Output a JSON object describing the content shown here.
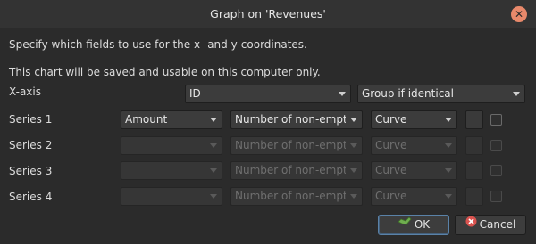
{
  "dialog": {
    "title": "Graph on 'Revenues'",
    "intro_line1": "Specify which fields to use for the x- and y-coordinates.",
    "intro_line2": "This chart will be saved and usable on this computer only."
  },
  "xaxis": {
    "label": "X-axis",
    "field": "ID",
    "grouping": "Group if identical"
  },
  "series": [
    {
      "label": "Series 1",
      "field": "Amount",
      "aggregate": "Number of non-empt",
      "style": "Curve"
    },
    {
      "label": "Series 2",
      "field": "",
      "aggregate": "Number of non-empt",
      "style": "Curve"
    },
    {
      "label": "Series 3",
      "field": "",
      "aggregate": "Number of non-empt",
      "style": "Curve"
    },
    {
      "label": "Series 4",
      "field": "",
      "aggregate": "Number of non-empt",
      "style": "Curve"
    }
  ],
  "buttons": {
    "ok_label": "OK",
    "cancel_label": "Cancel"
  },
  "icons": {
    "close": "close-icon",
    "ok": "ok-icon",
    "cancel": "cancel-icon"
  },
  "colors": {
    "close_button": "#e8896b",
    "ok_focus_border": "#5a82a8",
    "ok_icon": "#6fae4f",
    "cancel_icon": "#d9534f"
  }
}
